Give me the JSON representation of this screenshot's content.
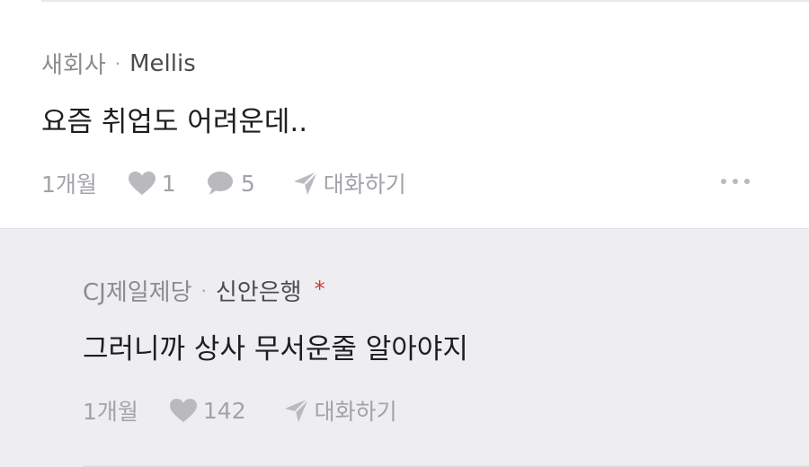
{
  "comment": {
    "company": "새회사",
    "separator": "·",
    "author": "Mellis",
    "text": "요즘 취업도 어려운데..",
    "time": "1개월",
    "likes": "1",
    "replies": "5",
    "chat_label": "대화하기",
    "icons": [
      "heart-icon",
      "speech-bubble-icon",
      "paper-plane-icon",
      "more-dots-icon"
    ]
  },
  "reply": {
    "company": "CJ제일제당",
    "separator": "·",
    "author": "신안은행",
    "author_marker": "*",
    "text": "그러니까 상사 무서운줄 알아야지",
    "time": "1개월",
    "likes": "142",
    "chat_label": "대화하기",
    "icons": [
      "heart-icon",
      "paper-plane-icon"
    ]
  },
  "colors": {
    "reply_background": "#eeeef1",
    "marker_red": "#d23b3b"
  }
}
